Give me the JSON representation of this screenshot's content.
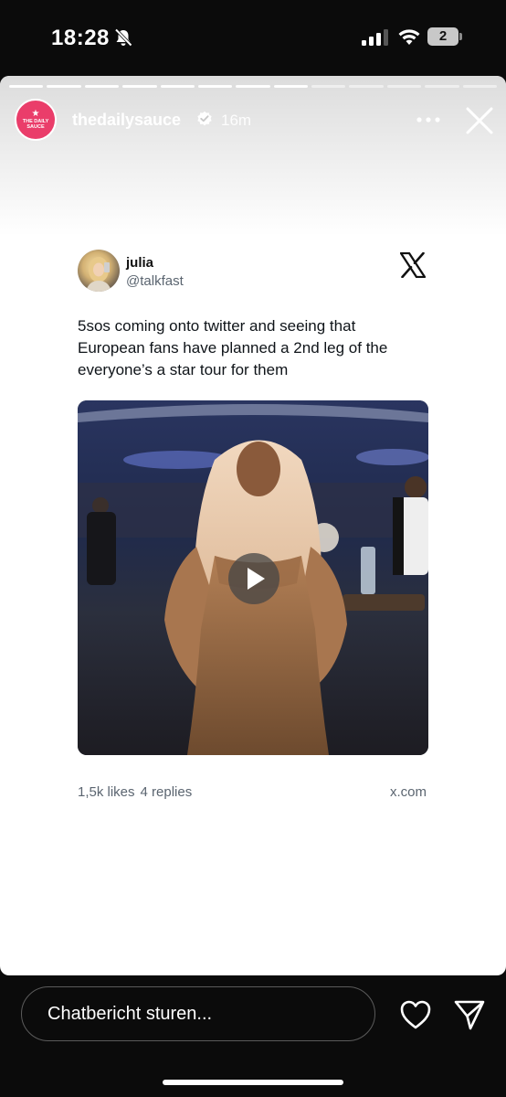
{
  "status_bar": {
    "time": "18:28",
    "battery": "2",
    "icons": [
      "bell-slash-icon",
      "cellular-signal-icon",
      "wifi-icon",
      "battery-icon"
    ]
  },
  "story": {
    "progress_segments": 13,
    "progress_fraction": 0.68,
    "account": {
      "username": "thedailysauce",
      "avatar_text": "THE DAILY SAUCE",
      "verified": true,
      "posted_ago": "16m"
    },
    "header_icons": [
      "more-icon",
      "close-icon"
    ]
  },
  "tweet": {
    "name": "julia",
    "handle": "@talkfast",
    "text_lines": [
      "5sos coming onto twitter and seeing that",
      "European fans have planned a 2nd leg of the",
      "everyone’s a star tour for them"
    ],
    "media": {
      "type": "video",
      "play_icon": "play-icon"
    },
    "likes": "1,5k likes",
    "replies": "4 replies",
    "source": "x.com",
    "platform_icon": "x-logo-icon"
  },
  "composer": {
    "placeholder": "Chatbericht sturen...",
    "icons": [
      "heart-icon",
      "send-icon"
    ]
  },
  "colors": {
    "background": "#0b0b0b",
    "brand_pink": "#ea3d6a",
    "story_card": "#ffffff",
    "muted_text": "#5b6570"
  }
}
